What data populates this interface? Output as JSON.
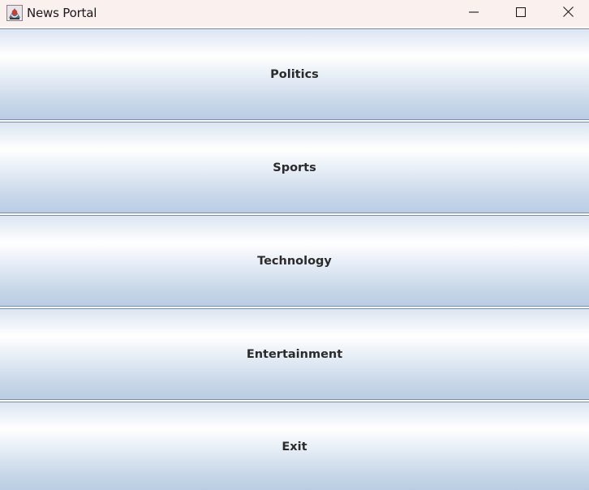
{
  "window": {
    "title": "News Portal",
    "controls": {
      "minimize": "minimize-icon",
      "maximize": "maximize-icon",
      "close": "close-icon"
    }
  },
  "menu": {
    "buttons": [
      {
        "label": "Politics"
      },
      {
        "label": "Sports"
      },
      {
        "label": "Technology"
      },
      {
        "label": "Entertainment"
      },
      {
        "label": "Exit"
      }
    ]
  },
  "colors": {
    "titlebar_bg": "#faf1ee",
    "button_gradient_top": "#dbe5f1",
    "button_gradient_highlight": "#ffffff",
    "button_gradient_bottom": "#b9cde3",
    "button_border": "#7b8ea7",
    "label_text": "#2b2b2b"
  }
}
